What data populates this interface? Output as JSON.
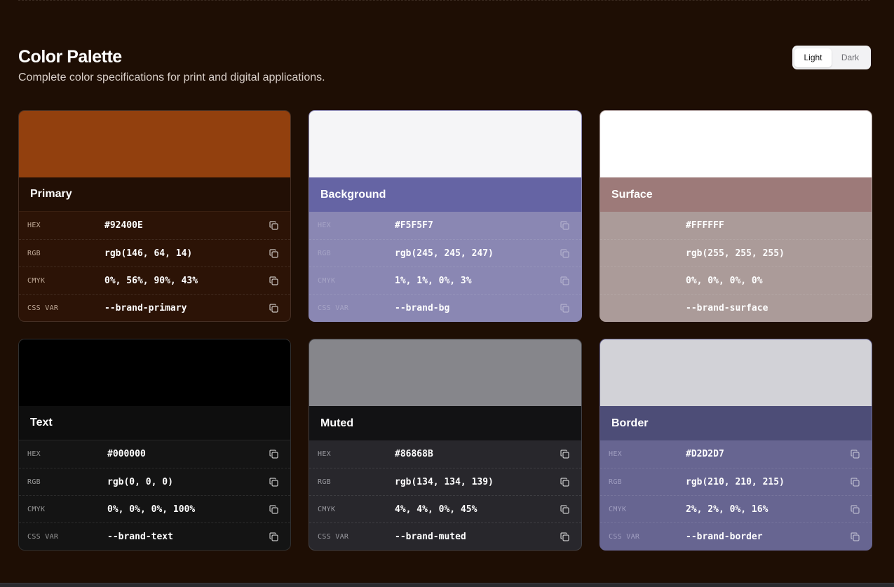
{
  "header": {
    "title": "Color Palette",
    "subtitle": "Complete color specifications for print and digital applications.",
    "theme_toggle": {
      "options": [
        "Light",
        "Dark"
      ],
      "active": "Light"
    }
  },
  "spec_labels": {
    "hex": "HEX",
    "rgb": "RGB",
    "cmyk": "CMYK",
    "css": "CSS VAR"
  },
  "colors": [
    {
      "name": "Primary",
      "hex": "#92400E",
      "rgb": "rgb(146, 64, 14)",
      "cmyk": "0%, 56%, 90%, 43%",
      "css_var": "--brand-primary",
      "swatch": "#92400E"
    },
    {
      "name": "Background",
      "hex": "#F5F5F7",
      "rgb": "rgb(245, 245, 247)",
      "cmyk": "1%, 1%, 0%, 3%",
      "css_var": "--brand-bg",
      "swatch": "#F5F5F7"
    },
    {
      "name": "Surface",
      "hex": "#FFFFFF",
      "rgb": "rgb(255, 255, 255)",
      "cmyk": "0%, 0%, 0%, 0%",
      "css_var": "--brand-surface",
      "swatch": "#FFFFFF"
    },
    {
      "name": "Text",
      "hex": "#000000",
      "rgb": "rgb(0, 0, 0)",
      "cmyk": "0%, 0%, 0%, 100%",
      "css_var": "--brand-text",
      "swatch": "#000000"
    },
    {
      "name": "Muted",
      "hex": "#86868B",
      "rgb": "rgb(134, 134, 139)",
      "cmyk": "4%, 4%, 0%, 45%",
      "css_var": "--brand-muted",
      "swatch": "#86868B"
    },
    {
      "name": "Border",
      "hex": "#D2D2D7",
      "rgb": "rgb(210, 210, 215)",
      "cmyk": "2%, 2%, 0%, 16%",
      "css_var": "--brand-border",
      "swatch": "#D2D2D7"
    }
  ],
  "icons": {
    "copy": "copy-icon"
  }
}
